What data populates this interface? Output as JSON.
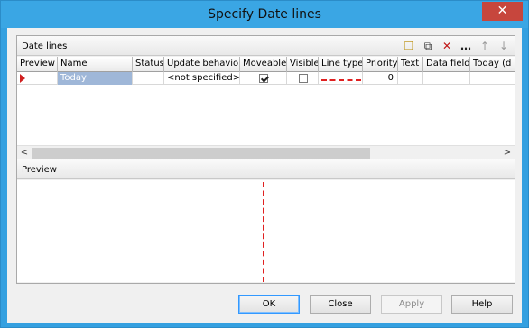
{
  "window": {
    "title": "Specify Date lines",
    "close_glyph": "✕"
  },
  "date_lines": {
    "title": "Date lines",
    "toolbar": [
      {
        "name": "new-icon",
        "glyph": "❐"
      },
      {
        "name": "copy-icon",
        "glyph": "⧉"
      },
      {
        "name": "delete-icon",
        "glyph": "✕"
      },
      {
        "name": "more-icon",
        "glyph": "…"
      },
      {
        "name": "move-up-icon",
        "glyph": "↑"
      },
      {
        "name": "move-down-icon",
        "glyph": "↓"
      }
    ],
    "columns": [
      "Preview",
      "Name",
      "Status",
      "Update behavior",
      "Moveable",
      "Visible",
      "Line type",
      "Priority",
      "Text",
      "Data field",
      "Today (d"
    ],
    "row": {
      "name": "Today",
      "status": "",
      "update_behavior": "<not specified>",
      "moveable": true,
      "visible": false,
      "priority": "0"
    },
    "scroll_left": "<",
    "scroll_right": ">"
  },
  "preview": {
    "title": "Preview"
  },
  "buttons": {
    "ok": "OK",
    "close": "Close",
    "apply": "Apply",
    "help": "Help"
  },
  "colors": {
    "title_bar": "#3aa6e4",
    "close_button": "#c7463d",
    "line_color": "#e02020",
    "selection": "#9fb7d8"
  }
}
